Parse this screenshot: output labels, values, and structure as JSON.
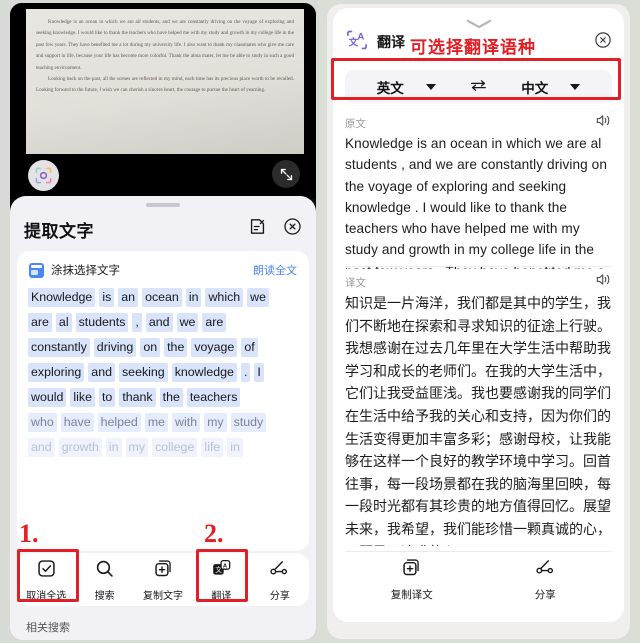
{
  "left_phone": {
    "photo": {
      "lens_icon": "lens-scan-icon",
      "expand_icon": "expand-arrows-icon",
      "paragraphs": [
        "Knowledge is an ocean in which we are all students, and we are constantly driving on the voyage of exploring and seeking knowledge. I would like to thank the teachers who have helped me with my study and growth in my college life in the past few years. They have benefited me a lot during my university life. I also want to thank my classmates who give me care and support in life, because your life has become more colorful. Thank the alma mater, let me be able to study in such a good teaching environment.",
        "Looking back on the past, all the scenes are reflected in my mind, each time has its precious place worth to be recalled. Looking forward to the future, I wish we can cherish a sincere heart, the courage to pursue the heart of yearning."
      ]
    },
    "sheet": {
      "title": "提取文字",
      "edit_icon": "edit-note-icon",
      "close_icon": "close-circle-icon",
      "smear_label": "涂抹选择文字",
      "smear_icon": "smear-select-icon",
      "read_all_label": "朗读全文",
      "word_lines": [
        {
          "state": "selected",
          "words": [
            "Knowledge",
            "is",
            "an",
            "ocean",
            "in",
            "which",
            "we"
          ]
        },
        {
          "state": "selected",
          "words": [
            "are",
            "al",
            "students",
            ",",
            "and",
            "we",
            "are"
          ]
        },
        {
          "state": "selected",
          "words": [
            "constantly",
            "driving",
            "on",
            "the",
            "voyage",
            "of"
          ]
        },
        {
          "state": "selected",
          "words": [
            "exploring",
            "and",
            "seeking",
            "knowledge",
            ".",
            "I"
          ]
        },
        {
          "state": "selected",
          "words": [
            "would",
            "like",
            "to",
            "thank",
            "the",
            "teachers"
          ]
        },
        {
          "state": "faded1",
          "words": [
            "who",
            "have",
            "helped",
            "me",
            "with",
            "my",
            "study"
          ]
        },
        {
          "state": "faded2",
          "words": [
            "and",
            "growth",
            "in",
            "my",
            "college",
            "life",
            "in"
          ]
        }
      ],
      "toolbar": [
        {
          "label": "取消全选",
          "icon": "checkbox-checked-icon"
        },
        {
          "label": "搜索",
          "icon": "search-icon"
        },
        {
          "label": "复制文字",
          "icon": "copy-plus-icon"
        },
        {
          "label": "翻译",
          "icon": "translate-icon"
        },
        {
          "label": "分享",
          "icon": "share-nodes-icon"
        }
      ],
      "related_search_label": "相关搜索"
    },
    "annotations": [
      {
        "number": "1.",
        "target": "取消全选"
      },
      {
        "number": "2.",
        "target": "翻译"
      }
    ]
  },
  "right_phone": {
    "chevron_icon": "chevron-down-icon",
    "app_icon": "translate-app-icon",
    "app_name": "翻译",
    "close_icon": "close-circle-icon",
    "annotation": "可选择翻译语种",
    "language": {
      "source": "英文",
      "target": "中文",
      "swap_icon": "swap-horizontal-icon",
      "caret_icon": "chevron-down-icon"
    },
    "source_section": {
      "label": "原文",
      "speaker_icon": "speaker-icon",
      "text": "Knowledge is an ocean in which we are al students , and we are constantly driving on the voyage of exploring and seeking knowledge . I would like to thank the teachers who have helped me with my study and growth in my college life in the past few years . They have benefited me a"
    },
    "target_section": {
      "label": "译文",
      "speaker_icon": "speaker-icon",
      "text": "知识是一片海洋，我们都是其中的学生，我们不断地在探索和寻求知识的征途上行驶。我想感谢在过去几年里在大学生活中帮助我学习和成长的老师们。在我的大学生活中，它们让我受益匪浅。我也要感谢我的同学们在生活中给予我的关心和支持，因为你们的生活变得更加丰富多彩；感谢母校，让我能够在这样一个良好的教学环境中学习。回首往事，每一段场景都在我的脑海里回映，每一段时光都有其珍贵的地方值得回忆。展望未来，我希望，我们能珍惜一颗真诚的心，一颗勇于追求的心！"
    },
    "bottom_bar": [
      {
        "label": "复制译文",
        "icon": "copy-plus-icon"
      },
      {
        "label": "分享",
        "icon": "share-nodes-icon"
      }
    ]
  },
  "colors": {
    "accent_red": "#e31f26",
    "link_blue": "#4a86f7",
    "highlight_blue": "#d9e4fb",
    "translate_purple": "#7b5fd6"
  }
}
